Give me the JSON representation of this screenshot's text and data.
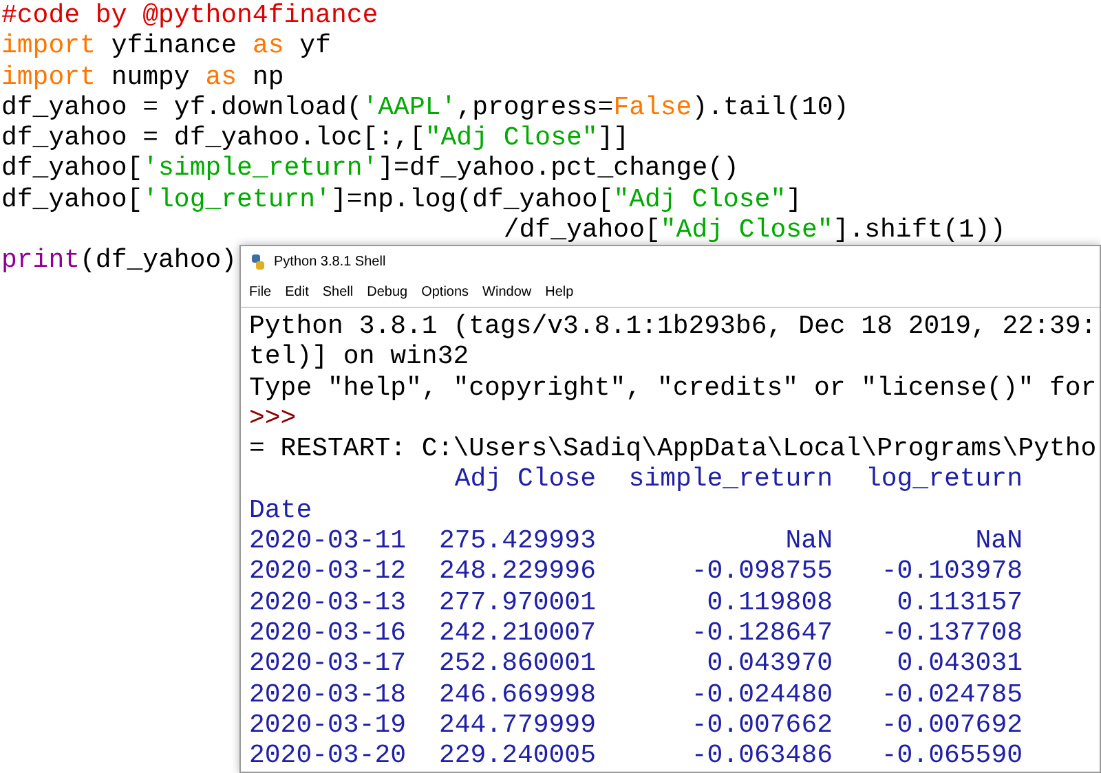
{
  "editor": {
    "lines": [
      [
        {
          "kind": "comment",
          "text": "#code by @python4finance"
        }
      ],
      [
        {
          "kind": "keyword",
          "text": "import"
        },
        {
          "kind": "plain",
          "text": " yfinance "
        },
        {
          "kind": "keyword",
          "text": "as"
        },
        {
          "kind": "plain",
          "text": " yf"
        }
      ],
      [
        {
          "kind": "keyword",
          "text": "import"
        },
        {
          "kind": "plain",
          "text": " numpy "
        },
        {
          "kind": "keyword",
          "text": "as"
        },
        {
          "kind": "plain",
          "text": " np"
        }
      ],
      [
        {
          "kind": "plain",
          "text": "df_yahoo = yf.download("
        },
        {
          "kind": "string",
          "text": "'AAPL'"
        },
        {
          "kind": "plain",
          "text": ",progress="
        },
        {
          "kind": "keyword",
          "text": "False"
        },
        {
          "kind": "plain",
          "text": ").tail(10)"
        }
      ],
      [
        {
          "kind": "plain",
          "text": "df_yahoo = df_yahoo.loc[:,["
        },
        {
          "kind": "string",
          "text": "\"Adj Close\""
        },
        {
          "kind": "plain",
          "text": "]]"
        }
      ],
      [
        {
          "kind": "plain",
          "text": "df_yahoo["
        },
        {
          "kind": "string",
          "text": "'simple_return'"
        },
        {
          "kind": "plain",
          "text": "]=df_yahoo.pct_change()"
        }
      ],
      [
        {
          "kind": "plain",
          "text": "df_yahoo["
        },
        {
          "kind": "string",
          "text": "'log_return'"
        },
        {
          "kind": "plain",
          "text": "]=np.log(df_yahoo["
        },
        {
          "kind": "string",
          "text": "\"Adj Close\""
        },
        {
          "kind": "plain",
          "text": "]"
        }
      ],
      [
        {
          "kind": "plain",
          "text": "                                /df_yahoo["
        },
        {
          "kind": "string",
          "text": "\"Adj Close\""
        },
        {
          "kind": "plain",
          "text": "].shift(1))"
        }
      ],
      [
        {
          "kind": "builtin",
          "text": "print"
        },
        {
          "kind": "plain",
          "text": "(df_yahoo)"
        }
      ]
    ]
  },
  "shell": {
    "title": "Python 3.8.1 Shell",
    "menu": [
      "File",
      "Edit",
      "Shell",
      "Debug",
      "Options",
      "Window",
      "Help"
    ],
    "lines": [
      {
        "kind": "banner",
        "text": "Python 3.8.1 (tags/v3.8.1:1b293b6, Dec 18 2019, 22:39:"
      },
      {
        "kind": "banner",
        "text": "tel)] on win32"
      },
      {
        "kind": "banner",
        "text": "Type \"help\", \"copyright\", \"credits\" or \"license()\" for"
      },
      {
        "kind": "prompt",
        "text": ">>>"
      },
      {
        "kind": "banner",
        "text": "= RESTART: C:\\Users\\Sadiq\\AppData\\Local\\Programs\\Pytho"
      }
    ],
    "table": {
      "columns": [
        "",
        "Adj Close",
        "simple_return",
        "log_return"
      ],
      "index_name": "Date",
      "rows": [
        [
          "2020-03-11",
          "275.429993",
          "NaN",
          "NaN"
        ],
        [
          "2020-03-12",
          "248.229996",
          "-0.098755",
          "-0.103978"
        ],
        [
          "2020-03-13",
          "277.970001",
          "0.119808",
          "0.113157"
        ],
        [
          "2020-03-16",
          "242.210007",
          "-0.128647",
          "-0.137708"
        ],
        [
          "2020-03-17",
          "252.860001",
          "0.043970",
          "0.043031"
        ],
        [
          "2020-03-18",
          "246.669998",
          "-0.024480",
          "-0.024785"
        ],
        [
          "2020-03-19",
          "244.779999",
          "-0.007662",
          "-0.007692"
        ],
        [
          "2020-03-20",
          "229.240005",
          "-0.063486",
          "-0.065590"
        ]
      ]
    }
  }
}
